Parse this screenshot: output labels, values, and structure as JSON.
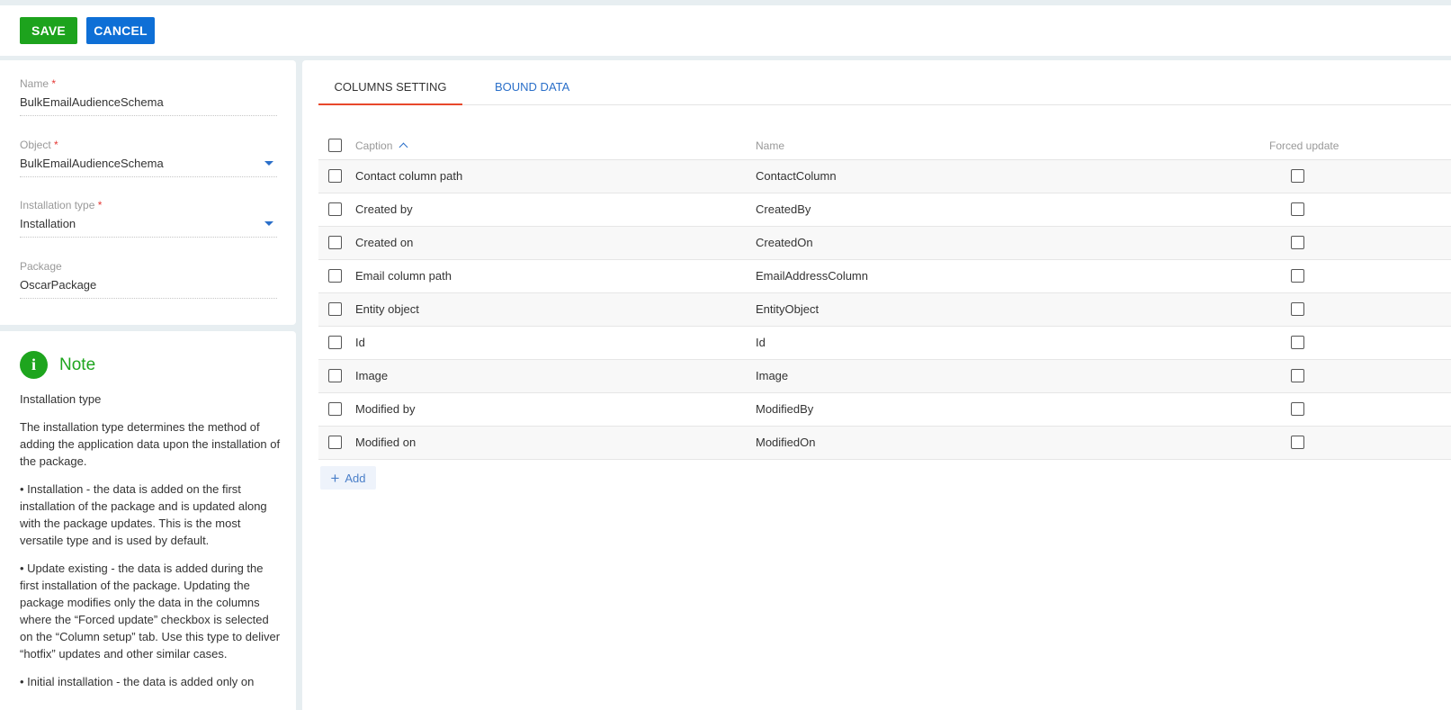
{
  "toolbar": {
    "save_label": "SAVE",
    "cancel_label": "CANCEL"
  },
  "form": {
    "name": {
      "label": "Name",
      "required_mark": "*",
      "value": "BulkEmailAudienceSchema"
    },
    "object": {
      "label": "Object",
      "required_mark": "*",
      "value": "BulkEmailAudienceSchema"
    },
    "installation_type": {
      "label": "Installation type",
      "required_mark": "*",
      "value": "Installation"
    },
    "package": {
      "label": "Package",
      "value": "OscarPackage"
    }
  },
  "note": {
    "icon": "i",
    "title": "Note",
    "paragraphs": [
      "Installation type",
      "The installation type determines the method of adding the application data upon the installation of the package.",
      "• Installation - the data is added on the first installation of the package and is updated along with the package updates. This is the most versatile type and is used by default.",
      "• Update existing - the data is added during the first installation of the package. Updating the package modifies only the data in the columns where the “Forced update” checkbox is selected on the “Column setup” tab. Use this type to deliver “hotfix” updates and other similar cases.",
      "• Initial installation - the data is added only on"
    ]
  },
  "tabs": [
    {
      "label": "COLUMNS SETTING"
    },
    {
      "label": "BOUND DATA"
    }
  ],
  "grid": {
    "headers": {
      "caption": "Caption",
      "name": "Name",
      "forced_update": "Forced update"
    },
    "rows": [
      {
        "caption": "Contact column path",
        "name": "ContactColumn"
      },
      {
        "caption": "Created by",
        "name": "CreatedBy"
      },
      {
        "caption": "Created on",
        "name": "CreatedOn"
      },
      {
        "caption": "Email column path",
        "name": "EmailAddressColumn"
      },
      {
        "caption": "Entity object",
        "name": "EntityObject"
      },
      {
        "caption": "Id",
        "name": "Id"
      },
      {
        "caption": "Image",
        "name": "Image"
      },
      {
        "caption": "Modified by",
        "name": "ModifiedBy"
      },
      {
        "caption": "Modified on",
        "name": "ModifiedOn"
      }
    ],
    "add_label": "Add"
  },
  "colors": {
    "save": "#1da31d",
    "cancel": "#0e6fd6",
    "note_accent": "#1ea51e",
    "tab_underline": "#e8472b",
    "link": "#2a6fc9"
  }
}
